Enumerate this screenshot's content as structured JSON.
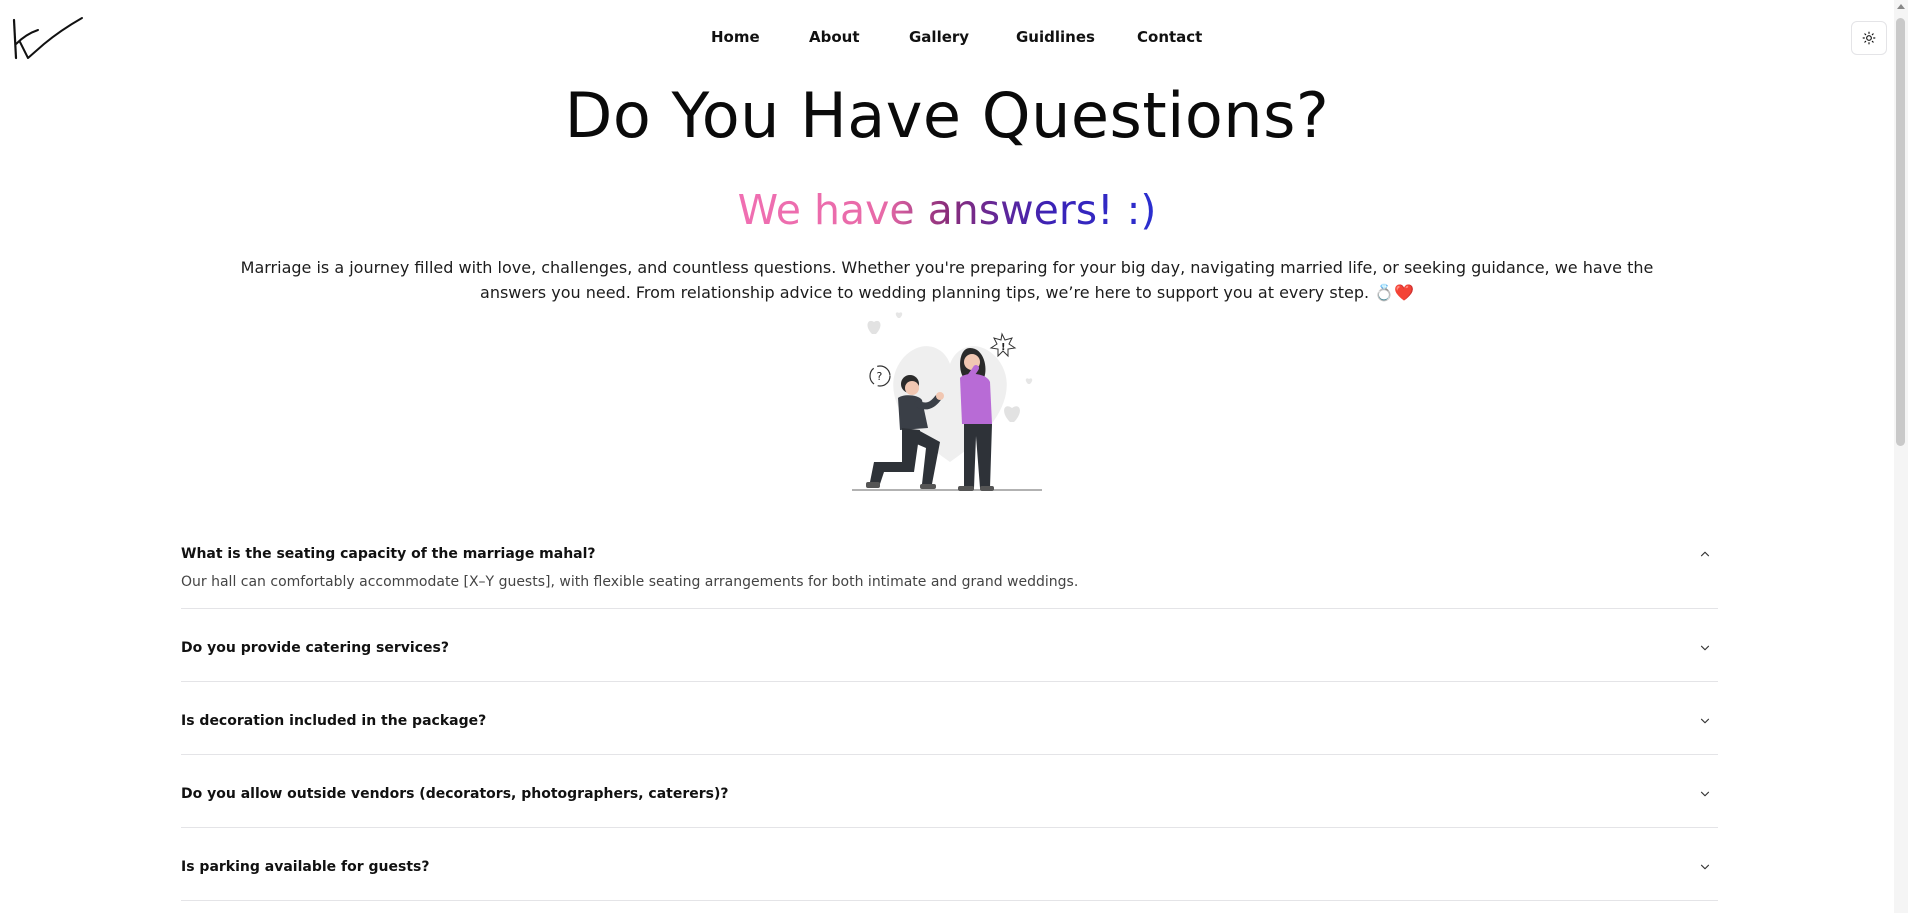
{
  "nav": {
    "items": [
      {
        "label": "Home"
      },
      {
        "label": "About"
      },
      {
        "label": "Gallery"
      },
      {
        "label": "Guidlines"
      },
      {
        "label": "Contact"
      }
    ]
  },
  "icons": {
    "logo": "signature-logo",
    "theme_toggle": "sun-icon",
    "chevron_up": "chevron-up-icon",
    "chevron_down": "chevron-down-icon"
  },
  "hero": {
    "title": "Do You Have Questions?",
    "tagline": "We have answers! :)",
    "intro": "Marriage is a journey filled with love, challenges, and countless questions. Whether you're preparing for your big day, navigating married life, or seeking guidance, we have the answers you need. From relationship advice to wedding planning tips, we’re here to support you at every step. 💍❤️"
  },
  "colors": {
    "gradient_start": "#f06fb2",
    "gradient_mid": "#8a2d7a",
    "gradient_end": "#2a2fd0",
    "divider": "#e4e4e7",
    "accent_purple": "#b86bd6"
  },
  "faq": [
    {
      "question": "What is the seating capacity of the marriage mahal?",
      "answer": "Our hall can comfortably accommodate [X–Y guests], with flexible seating arrangements for both intimate and grand weddings.",
      "expanded": true
    },
    {
      "question": "Do you provide catering services?",
      "expanded": false
    },
    {
      "question": "Is decoration included in the package?",
      "expanded": false
    },
    {
      "question": "Do you allow outside vendors (decorators, photographers, caterers)?",
      "expanded": false
    },
    {
      "question": "Is parking available for guests?",
      "expanded": false
    }
  ]
}
